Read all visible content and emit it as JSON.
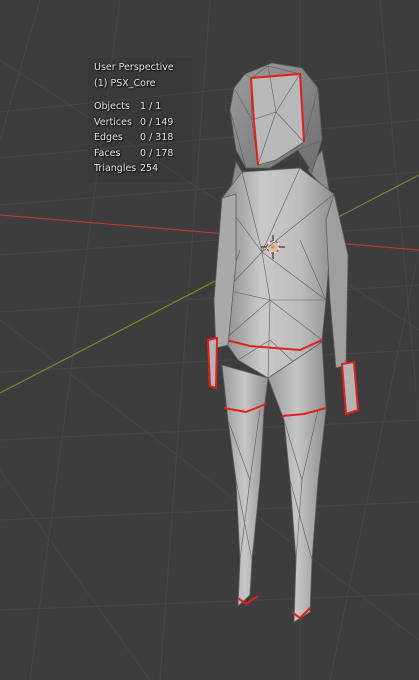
{
  "viewport": {
    "view_name": "User Perspective",
    "active_object": "(1) PSX_Core",
    "stats": [
      {
        "label": "Objects",
        "value": "1 / 1"
      },
      {
        "label": "Vertices",
        "value": "0 / 149"
      },
      {
        "label": "Edges",
        "value": "0 / 318"
      },
      {
        "label": "Faces",
        "value": "0 / 178"
      },
      {
        "label": "Triangles",
        "value": "254"
      }
    ]
  },
  "colors": {
    "background": "#3d3d3d",
    "grid": "#474747",
    "x_axis": "#b53a3a",
    "y_axis": "#6b8f2e",
    "mesh_fill": "#b8b8b8",
    "mesh_wire": "#5e5e5e",
    "seam": "#e02020"
  },
  "icons": {
    "origin": "3d-cursor-icon"
  }
}
